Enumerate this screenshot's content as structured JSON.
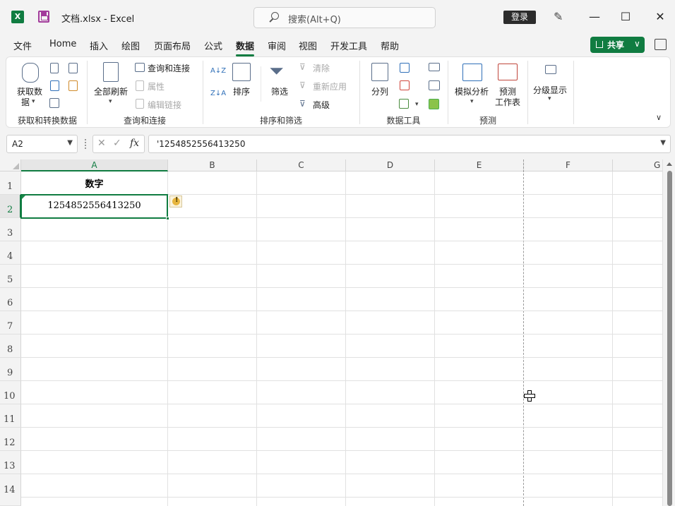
{
  "titlebar": {
    "app_logo": "X",
    "doc_title": "文档.xlsx  -  Excel",
    "search_placeholder": "搜索(Alt+Q)",
    "login_label": "登录",
    "minimize_glyph": "—",
    "maximize_glyph": "☐",
    "close_glyph": "✕"
  },
  "menu": {
    "tabs": [
      "文件",
      "Home",
      "插入",
      "绘图",
      "页面布局",
      "公式",
      "数据",
      "审阅",
      "视图",
      "开发工具",
      "帮助"
    ],
    "active_tab": "数据",
    "share_label": "共享",
    "share_arrow": "∨"
  },
  "ribbon": {
    "groups": {
      "get_data": "获取和转换数据",
      "queries": "查询和连接",
      "sort_filter": "排序和筛选",
      "data_tools": "数据工具",
      "forecast": "预测"
    },
    "labels": {
      "get_data_line1": "获取数",
      "get_data_line2": "据",
      "refresh_all": "全部刷新",
      "queries_connections": "查询和连接",
      "properties": "属性",
      "edit_links": "编辑链接",
      "sort": "排序",
      "filter": "筛选",
      "clear": "清除",
      "reapply": "重新应用",
      "advanced": "高级",
      "text_to_columns": "分列",
      "what_if": "模拟分析",
      "forecast_sheet_line1": "预测",
      "forecast_sheet_line2": "工作表",
      "outline": "分级显示",
      "sort_az": "A↓Z",
      "sort_za": "Z↓A"
    },
    "collapse_glyph": "∨"
  },
  "formula_bar": {
    "name_box": "A2",
    "cancel_glyph": "✕",
    "enter_glyph": "✓",
    "fx": "fx",
    "value": "'1254852556413250"
  },
  "sheet": {
    "columns": [
      "A",
      "B",
      "C",
      "D",
      "E",
      "F",
      "G"
    ],
    "rows": [
      "1",
      "2",
      "3",
      "4",
      "5",
      "6",
      "7",
      "8",
      "9",
      "10",
      "11",
      "12",
      "13",
      "14"
    ],
    "selected_column": "A",
    "selected_row": "2",
    "cells": {
      "A1": "数字",
      "A2": "1254852556413250"
    }
  },
  "colors": {
    "accent": "#107c41",
    "brand": "#107c41"
  }
}
